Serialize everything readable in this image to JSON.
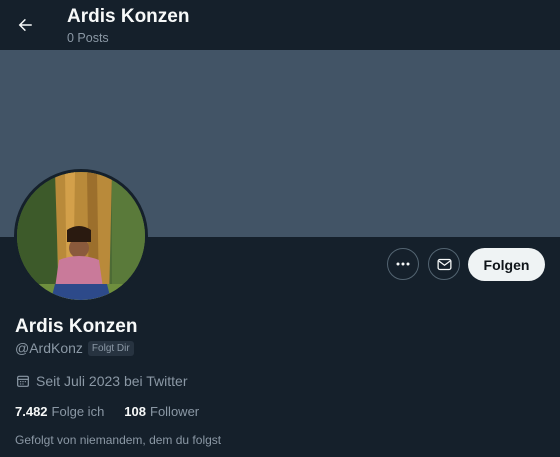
{
  "header": {
    "title": "Ardis Konzen",
    "post_count": "0 Posts"
  },
  "profile": {
    "name": "Ardis Konzen",
    "handle": "@ArdKonz",
    "follows_you_badge": "Folgt Dir",
    "joined": "Seit Juli 2023 bei Twitter",
    "following_count": "7.482",
    "following_label": "Folge ich",
    "followers_count": "108",
    "followers_label": "Follower",
    "followed_by": "Gefolgt von niemandem, dem du folgst"
  },
  "actions": {
    "follow_label": "Folgen",
    "more_icon": "more-horizontal-icon",
    "message_icon": "envelope-icon"
  },
  "colors": {
    "background": "#15202b",
    "banner": "#425466",
    "text": "#f7f9f9",
    "muted": "#8b98a5",
    "follow_button": "#eff3f4"
  }
}
